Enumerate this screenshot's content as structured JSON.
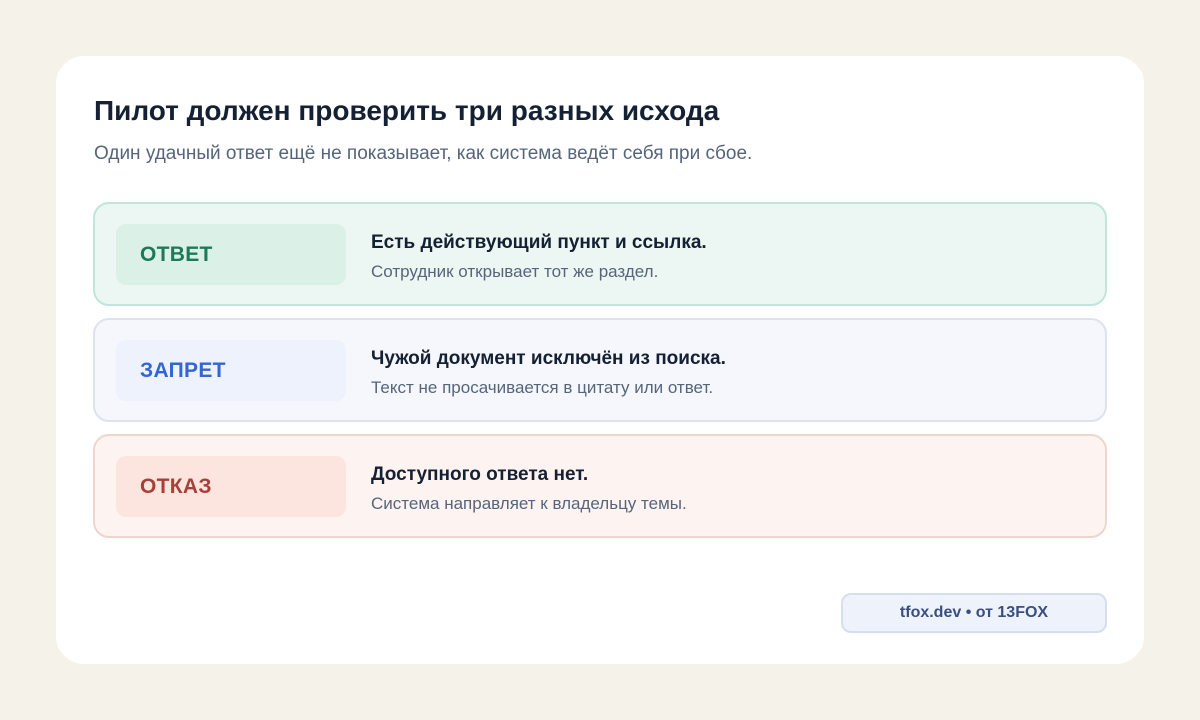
{
  "header": {
    "title": "Пилот должен проверить три разных исхода",
    "subtitle": "Один удачный ответ ещё не показывает, как система ведёт себя при сбое."
  },
  "outcomes": [
    {
      "tag": "ОТВЕТ",
      "title": "Есть действующий пункт и ссылка.",
      "description": "Сотрудник открывает тот же раздел.",
      "accent_color": "#1c7a5a"
    },
    {
      "tag": "ЗАПРЕТ",
      "title": "Чужой документ исключён из поиска.",
      "description": "Текст не просачивается в цитату или ответ.",
      "accent_color": "#3365d3"
    },
    {
      "tag": "ОТКАЗ",
      "title": "Доступного ответа нет.",
      "description": "Система направляет к владельцу темы.",
      "accent_color": "#a8403a"
    }
  ],
  "footer": {
    "credit": "tfox.dev • от 13FOX"
  },
  "colors": {
    "background": "#f5f2ea",
    "card": "#ffffff",
    "heading": "#142033",
    "muted": "#56657c"
  }
}
